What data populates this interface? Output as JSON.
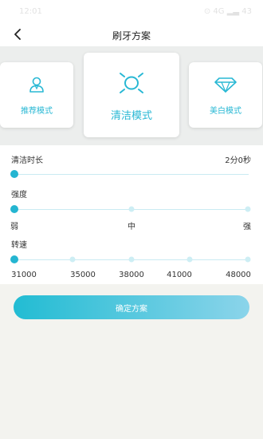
{
  "status_bar": {
    "time": "12:01",
    "right": "⊙ 4G ▂▃ 43"
  },
  "header": {
    "title": "刷牙方案"
  },
  "modes": [
    {
      "label": "推荐模式",
      "icon": "person-icon",
      "selected": false
    },
    {
      "label": "清洁模式",
      "icon": "sun-icon",
      "selected": true
    },
    {
      "label": "美白模式",
      "icon": "diamond-icon",
      "selected": false
    }
  ],
  "duration": {
    "label": "清洁时长",
    "value": "2分0秒",
    "level": 0
  },
  "intensity": {
    "label": "强度",
    "options": [
      "弱",
      "中",
      "强"
    ],
    "selected_index": 0
  },
  "speed": {
    "label": "转速",
    "options": [
      "31000",
      "35000",
      "38000",
      "41000",
      "48000"
    ],
    "selected_index": 0
  },
  "confirm": {
    "label": "确定方案"
  },
  "colors": {
    "accent": "#24b5d1",
    "track": "#c9ebf2",
    "background": "#f3f3ef"
  }
}
